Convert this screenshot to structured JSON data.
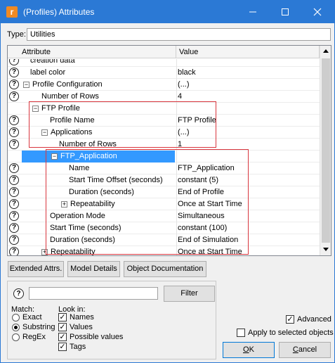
{
  "window": {
    "title": "(Profiles) Attributes",
    "app_icon_glyph": "r"
  },
  "type": {
    "label": "Type:",
    "value": "Utilities"
  },
  "table": {
    "columns": {
      "attribute": "Attribute",
      "value": "Value"
    },
    "rows": [
      {
        "attr": "creation data",
        "val": ""
      },
      {
        "attr": "label color",
        "val": "black"
      },
      {
        "attr": "Profile Configuration",
        "val": "(...)"
      },
      {
        "attr": "Number of Rows",
        "val": "4"
      },
      {
        "attr": "FTP Profile",
        "val": ""
      },
      {
        "attr": "Profile Name",
        "val": "FTP Profile"
      },
      {
        "attr": "Applications",
        "val": "(...)"
      },
      {
        "attr": "Number of Rows",
        "val": "1"
      },
      {
        "attr": "FTP_Application",
        "val": ""
      },
      {
        "attr": "Name",
        "val": "FTP_Application"
      },
      {
        "attr": "Start Time Offset (seconds)",
        "val": "constant (5)"
      },
      {
        "attr": "Duration (seconds)",
        "val": "End of Profile"
      },
      {
        "attr": "Repeatability",
        "val": "Once at Start Time"
      },
      {
        "attr": "Operation Mode",
        "val": "Simultaneous"
      },
      {
        "attr": "Start Time (seconds)",
        "val": "constant (100)"
      },
      {
        "attr": "Duration (seconds)",
        "val": "End of Simulation"
      },
      {
        "attr": "Repeatability",
        "val": "Once at Start Time"
      }
    ]
  },
  "buttons": {
    "extended_attrs": "Extended Attrs.",
    "model_details": "Model Details",
    "object_documentation": "Object Documentation",
    "filter": "Filter",
    "ok": "OK",
    "cancel": "Cancel"
  },
  "filter": {
    "match_label": "Match:",
    "look_in_label": "Look in:",
    "match_options": [
      "Exact",
      "Substring",
      "RegEx"
    ],
    "match_selected": "Substring",
    "look_in_options": [
      "Names",
      "Values",
      "Possible values",
      "Tags"
    ]
  },
  "options": {
    "advanced": "Advanced",
    "apply_to_selected": "Apply to selected objects"
  },
  "colors": {
    "titlebar": "#2b79d5",
    "selection": "#3399ff",
    "highlight_box": "#d9363e"
  }
}
